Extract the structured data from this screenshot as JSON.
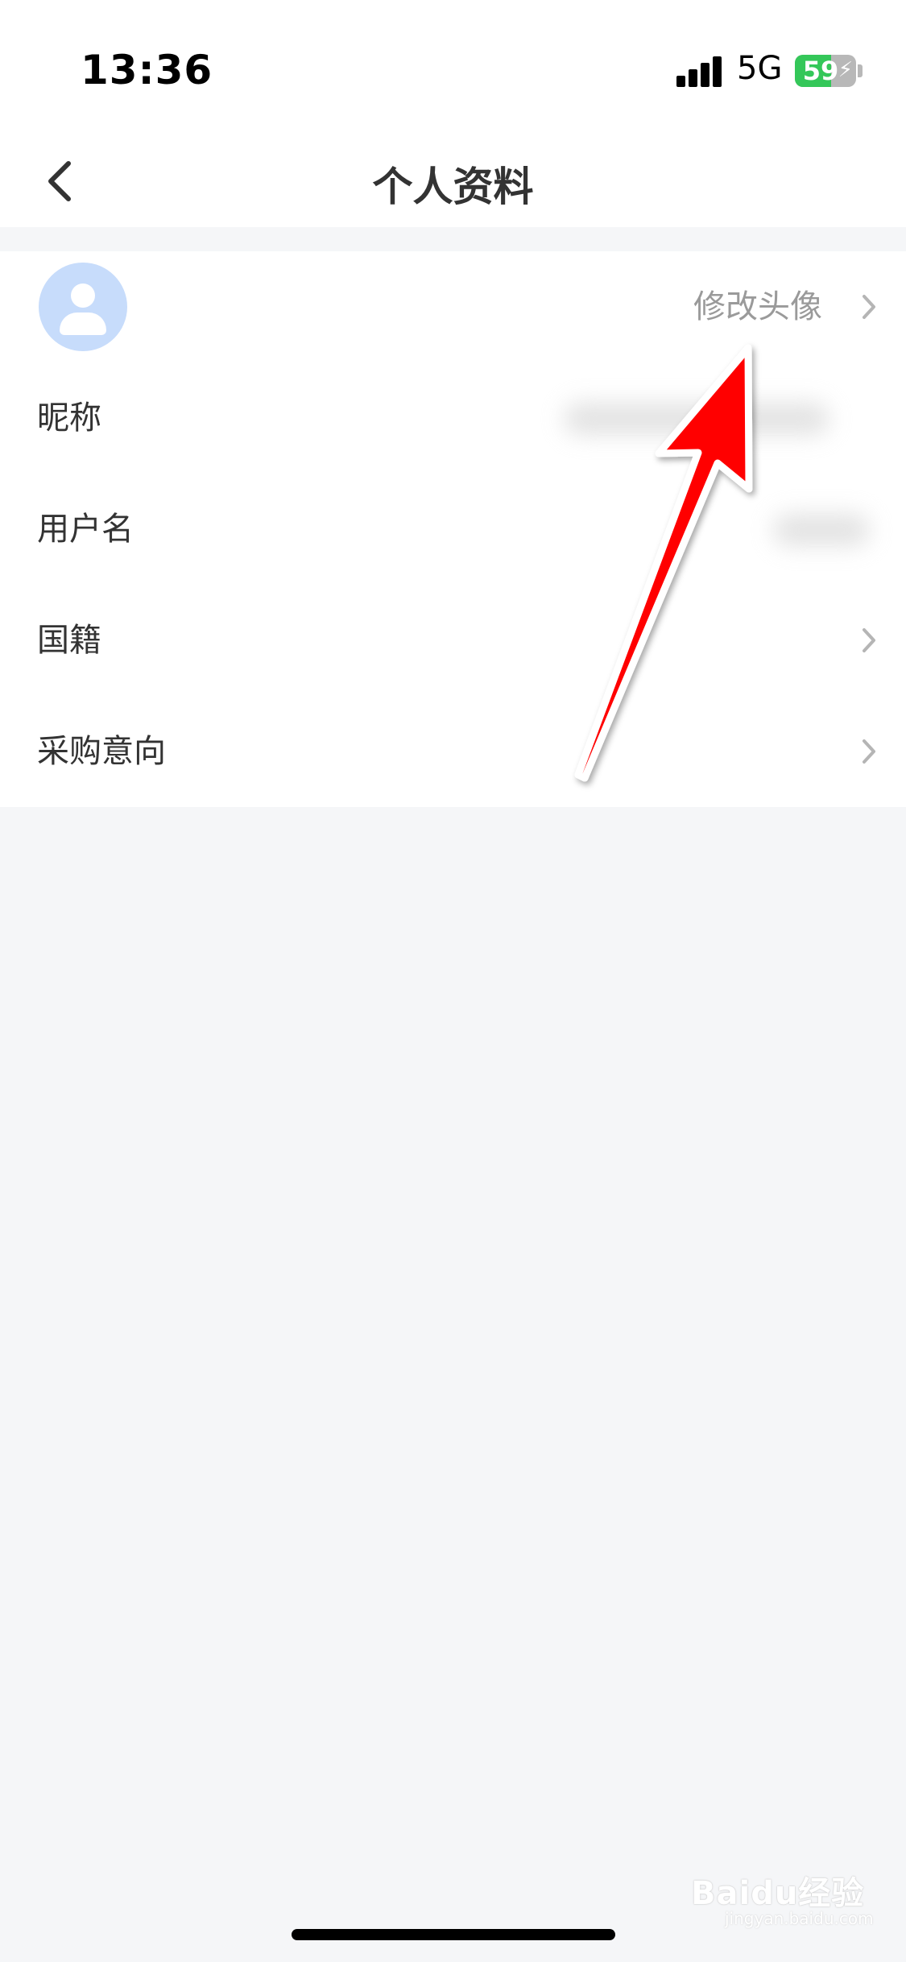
{
  "status_bar": {
    "time": "13:36",
    "network": "5G",
    "battery_level": "59",
    "battery_fraction": 0.59
  },
  "header": {
    "title": "个人资料"
  },
  "profile": {
    "edit_avatar_label": "修改头像",
    "items": [
      {
        "label": "昵称"
      },
      {
        "label": "用户名"
      },
      {
        "label": "国籍"
      },
      {
        "label": "采购意向"
      }
    ]
  },
  "watermark": {
    "brand": "Baidu经验",
    "url": "jingyan.baidu.com"
  },
  "colors": {
    "annotation_arrow": "#ff0000",
    "avatar_bg": "#c7dcfb",
    "battery_green": "#34c759",
    "page_bg": "#f5f6f8"
  },
  "icons": {
    "back": "chevron-left-icon",
    "row_arrow": "chevron-right-icon",
    "avatar": "user-icon"
  }
}
